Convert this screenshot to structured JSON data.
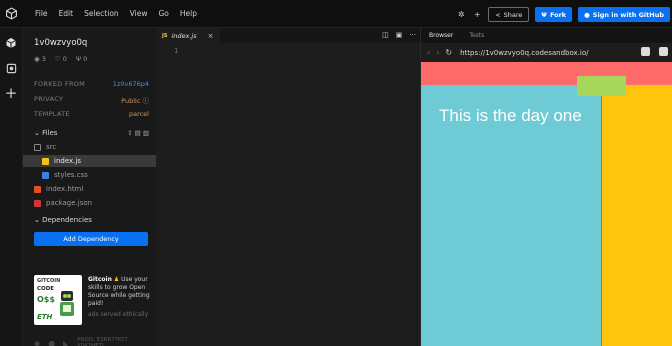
{
  "menubar": {
    "items": [
      "File",
      "Edit",
      "Selection",
      "View",
      "Go",
      "Help"
    ],
    "share_label": "Share",
    "fork_label": "Fork",
    "signin_label": "Sign in with GitHub"
  },
  "sidebar": {
    "sandbox_name": "1v0wzvyo0q",
    "stats": {
      "views": "3",
      "likes": "0",
      "forks": "0"
    },
    "forked_from_label": "FORKED FROM",
    "forked_from_value": "1z0v676p4",
    "privacy_label": "PRIVACY",
    "privacy_value": "Public",
    "template_label": "TEMPLATE",
    "template_value": "parcel",
    "files_label": "Files",
    "files": [
      {
        "name": "src",
        "type": "folder"
      },
      {
        "name": "index.js",
        "type": "js"
      },
      {
        "name": "styles.css",
        "type": "css"
      },
      {
        "name": "index.html",
        "type": "html"
      },
      {
        "name": "package.json",
        "type": "json"
      }
    ],
    "dependencies_label": "Dependencies",
    "add_dependency_label": "Add Dependency",
    "ad": {
      "brand": "GITCOIN",
      "image_text_1": "CODE",
      "image_text_2": "O$$",
      "image_text_3": "ETH",
      "headline": "Gitcoin",
      "body": "Use your skills to grow Open Source while getting paid!",
      "served": "ads served ethically"
    },
    "footer_text": "PROD: ESBR7TKT7 Y047HETJ"
  },
  "editor": {
    "tab_label": "index.js",
    "line_numbers": [
      "1"
    ]
  },
  "browser": {
    "tabs": [
      "Browser",
      "Tests"
    ],
    "url": "https://1v0wzvyo0q.codesandbox.io/",
    "page_text": "This is the day one",
    "colors": {
      "top": "#ff6b6b",
      "green": "#a8d65a",
      "teal": "#6ecbd5",
      "yellow": "#ffc50d"
    }
  }
}
